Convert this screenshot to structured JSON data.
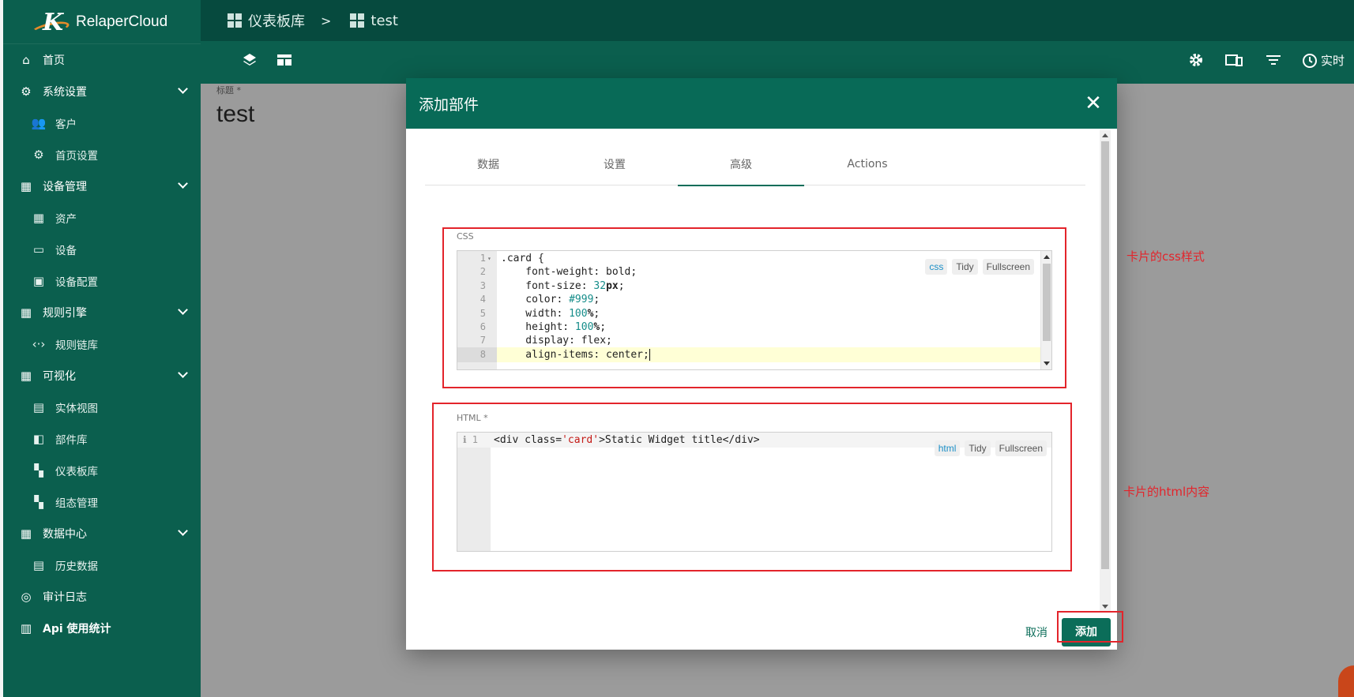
{
  "app": {
    "name": "RelaperCloud"
  },
  "sidebar": {
    "items": [
      {
        "label": "首页",
        "icon": "home-icon",
        "sub": false,
        "expand": false
      },
      {
        "label": "系统设置",
        "icon": "gear-icon",
        "sub": false,
        "expand": true
      },
      {
        "label": "客户",
        "icon": "users-icon",
        "sub": true,
        "expand": false
      },
      {
        "label": "首页设置",
        "icon": "settings-box-icon",
        "sub": true,
        "expand": false
      },
      {
        "label": "设备管理",
        "icon": "building-icon",
        "sub": false,
        "expand": true
      },
      {
        "label": "资产",
        "icon": "building-icon",
        "sub": true,
        "expand": false
      },
      {
        "label": "设备",
        "icon": "devices-icon",
        "sub": true,
        "expand": false
      },
      {
        "label": "设备配置",
        "icon": "device-profile-icon",
        "sub": true,
        "expand": false
      },
      {
        "label": "规则引擎",
        "icon": "building-icon",
        "sub": false,
        "expand": true
      },
      {
        "label": "规则链库",
        "icon": "code-icon",
        "sub": true,
        "expand": false
      },
      {
        "label": "可视化",
        "icon": "building-icon",
        "sub": false,
        "expand": true
      },
      {
        "label": "实体视图",
        "icon": "view-icon",
        "sub": true,
        "expand": false
      },
      {
        "label": "部件库",
        "icon": "widgets-icon",
        "sub": true,
        "expand": false
      },
      {
        "label": "仪表板库",
        "icon": "dashboard-icon",
        "sub": true,
        "expand": false
      },
      {
        "label": "组态管理",
        "icon": "dashboard-icon",
        "sub": true,
        "expand": false
      },
      {
        "label": "数据中心",
        "icon": "building-icon",
        "sub": false,
        "expand": true
      },
      {
        "label": "历史数据",
        "icon": "view-icon",
        "sub": true,
        "expand": false
      },
      {
        "label": "审计日志",
        "icon": "track-icon",
        "sub": false,
        "expand": false
      },
      {
        "label": "Api 使用统计",
        "icon": "chart-icon",
        "sub": false,
        "expand": false
      }
    ]
  },
  "breadcrumb": {
    "root": "仪表板库",
    "separator": ">",
    "current": "test"
  },
  "toolbar": {
    "realtime_label": "实时"
  },
  "main": {
    "field_label": "标题 *",
    "title": "test"
  },
  "dialog": {
    "title": "添加部件",
    "close": "✕",
    "tabs": [
      "数据",
      "设置",
      "高级",
      "Actions"
    ],
    "active_tab": 2,
    "css_label": "CSS",
    "html_label": "HTML *",
    "css_mode": "css",
    "html_mode": "html",
    "tidy": "Tidy",
    "fullscreen": "Fullscreen",
    "cancel": "取消",
    "add": "添加",
    "html_code": "<div class='card'>Static Widget title</div>"
  },
  "css_lines": [
    ".card {",
    "    font-weight: bold;",
    "    font-size: 32px;",
    "    color: #999;",
    "    width: 100%;",
    "    height: 100%;",
    "    display: flex;",
    "    align-items: center;"
  ],
  "annotations": {
    "css_note": "卡片的css样式",
    "html_note": "卡片的html内容"
  },
  "colors": {
    "primary": "#0b5f4e",
    "accent": "#0b6d59",
    "highlight": "#e3242b"
  }
}
